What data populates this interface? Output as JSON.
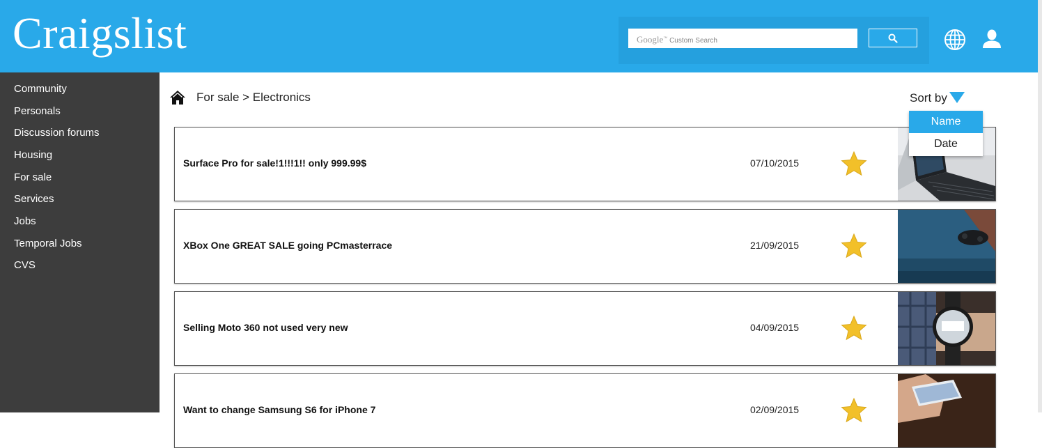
{
  "header": {
    "logo": "Craigslist",
    "search": {
      "brand": "Google",
      "placeholder_suffix": "Custom Search"
    },
    "brand_color": "#29a9e9",
    "icons": [
      "search-icon",
      "globe-icon",
      "user-icon"
    ]
  },
  "sidebar": {
    "items": [
      {
        "label": "Community"
      },
      {
        "label": "Personals"
      },
      {
        "label": "Discussion forums"
      },
      {
        "label": "Housing"
      },
      {
        "label": "For sale"
      },
      {
        "label": "Services"
      },
      {
        "label": "Jobs"
      },
      {
        "label": "Temporal Jobs"
      },
      {
        "label": "CVS"
      }
    ]
  },
  "breadcrumb": {
    "text": "For sale > Electronics"
  },
  "sort": {
    "label": "Sort by",
    "options": [
      {
        "label": "Name",
        "selected": true
      },
      {
        "label": "Date",
        "selected": false
      }
    ]
  },
  "listings": [
    {
      "title": "Surface Pro for sale!1!!!1!! only 999.99$",
      "date": "07/10/2015",
      "favorite": true
    },
    {
      "title": "XBox One GREAT SALE going PCmasterrace",
      "date": "21/09/2015",
      "favorite": true
    },
    {
      "title": "Selling Moto 360 not used very new",
      "date": "04/09/2015",
      "favorite": true
    },
    {
      "title": "Want to change Samsung S6 for iPhone 7",
      "date": "02/09/2015",
      "favorite": true
    }
  ]
}
